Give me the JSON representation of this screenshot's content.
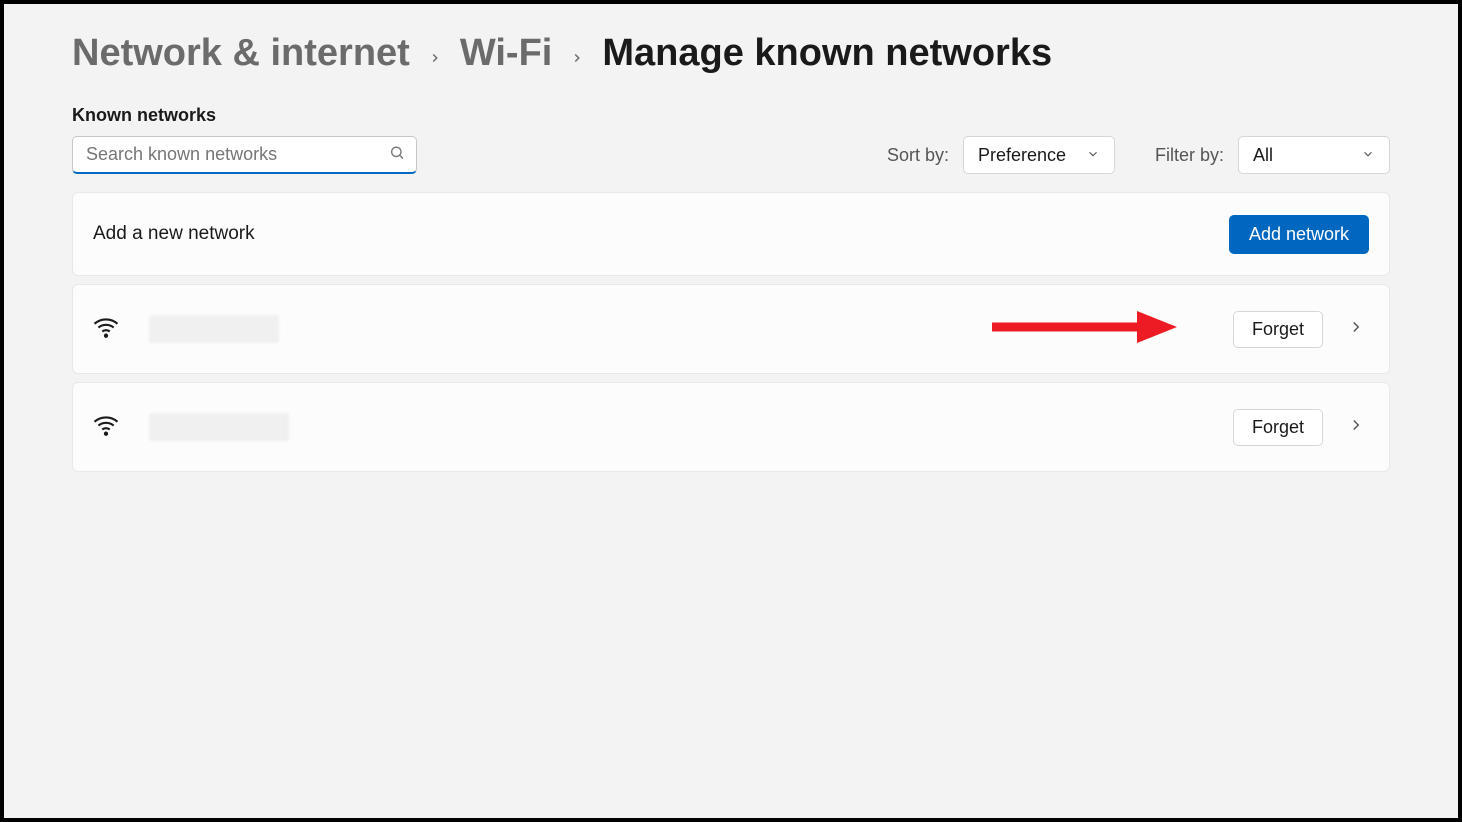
{
  "breadcrumb": {
    "level1": "Network & internet",
    "level2": "Wi-Fi",
    "level3": "Manage known networks"
  },
  "section_label": "Known networks",
  "search": {
    "placeholder": "Search known networks"
  },
  "sort": {
    "label": "Sort by:",
    "value": "Preference"
  },
  "filter": {
    "label": "Filter by:",
    "value": "All"
  },
  "add_row": {
    "label": "Add a new network",
    "button": "Add network"
  },
  "networks": [
    {
      "forget": "Forget"
    },
    {
      "forget": "Forget"
    }
  ]
}
